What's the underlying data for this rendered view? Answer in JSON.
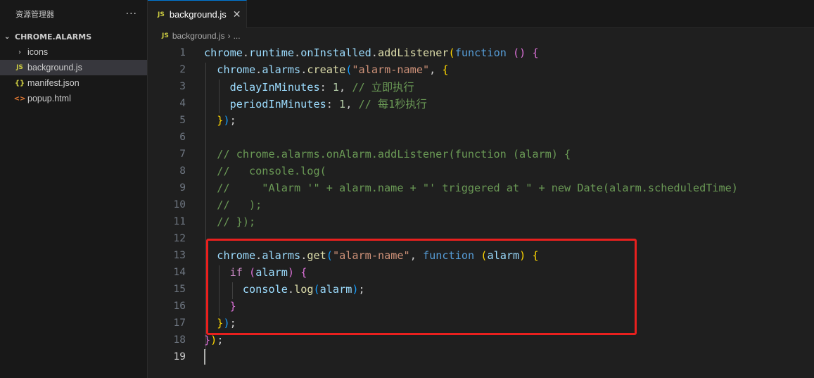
{
  "sidebar": {
    "title": "资源管理器",
    "more": "···",
    "section": "CHROME.ALARMS",
    "items": [
      {
        "label": "icons",
        "icon": "chevron-right-icon",
        "glyph": "›"
      },
      {
        "label": "background.js",
        "icon": "js-file-icon",
        "glyph": "JS"
      },
      {
        "label": "manifest.json",
        "icon": "json-file-icon",
        "glyph": "{}"
      },
      {
        "label": "popup.html",
        "icon": "html-file-icon",
        "glyph": "<>"
      }
    ]
  },
  "tab": {
    "label": "background.js",
    "icon_glyph": "JS",
    "close": "✕"
  },
  "breadcrumb": {
    "file": "background.js",
    "sep": "›",
    "rest": "...",
    "icon_glyph": "JS"
  },
  "editor": {
    "line_numbers": [
      "1",
      "2",
      "3",
      "4",
      "5",
      "6",
      "7",
      "8",
      "9",
      "10",
      "11",
      "12",
      "13",
      "14",
      "15",
      "16",
      "17",
      "18",
      "19"
    ],
    "active_line": "19",
    "code": {
      "l1": {
        "chrome": "chrome",
        "runtime": "runtime",
        "onInstalled": "onInstalled",
        "addListener": "addListener",
        "function_kw": "function"
      },
      "l2": {
        "chrome": "chrome",
        "alarms": "alarms",
        "create": "create",
        "name": "\"alarm-name\""
      },
      "l3": {
        "key": "delayInMinutes",
        "value": "1",
        "comment": "// 立即执行"
      },
      "l4": {
        "key": "periodInMinutes",
        "value": "1",
        "comment": "// 每1秒执行"
      },
      "l7": "// chrome.alarms.onAlarm.addListener(function (alarm) {",
      "l8": "//   console.log(",
      "l9": "//     \"Alarm '\" + alarm.name + \"' triggered at \" + new Date(alarm.scheduledTime)",
      "l10": "//   );",
      "l11": "// });",
      "l13": {
        "chrome": "chrome",
        "alarms": "alarms",
        "get": "get",
        "name": "\"alarm-name\"",
        "function_kw": "function",
        "param": "alarm"
      },
      "l14": {
        "if_kw": "if",
        "param": "alarm"
      },
      "l15": {
        "console": "console",
        "log": "log",
        "param": "alarm"
      }
    }
  },
  "colors": {
    "highlight_box": "#e8201e",
    "accent": "#0078d4"
  }
}
